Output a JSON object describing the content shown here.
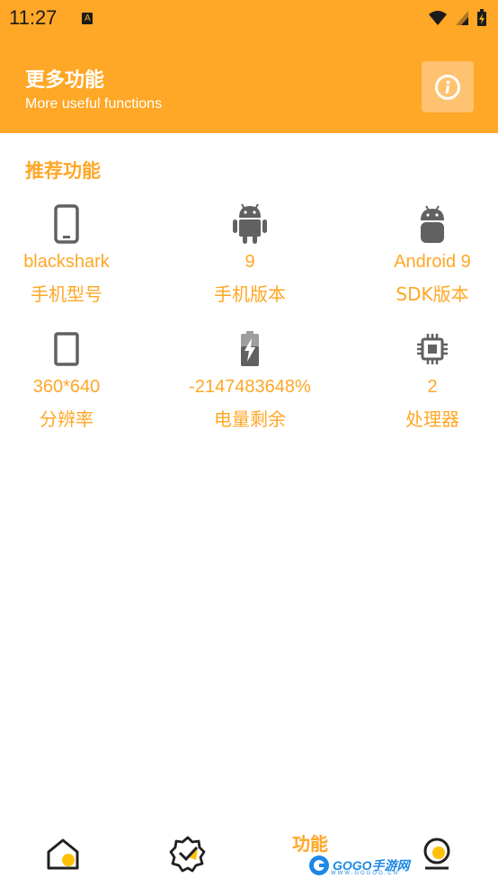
{
  "status_bar": {
    "time": "11:27",
    "notification_letter": "A"
  },
  "header": {
    "title": "更多功能",
    "subtitle": "More useful functions",
    "info_icon": "info-icon"
  },
  "section": {
    "title": "推荐功能"
  },
  "features": [
    {
      "icon": "phone-icon",
      "value": "blackshark",
      "label": "手机型号"
    },
    {
      "icon": "android-icon",
      "value": "9",
      "label": "手机版本"
    },
    {
      "icon": "android-head-icon",
      "value": "Android 9",
      "label": "SDK版本"
    },
    {
      "icon": "tablet-icon",
      "value": "360*640",
      "label": "分辨率"
    },
    {
      "icon": "battery-charging-icon",
      "value": "-2147483648%",
      "label": "电量剩余"
    },
    {
      "icon": "cpu-icon",
      "value": "2",
      "label": "处理器"
    }
  ],
  "bottom_nav": {
    "active_label": "功能"
  },
  "watermark": {
    "text": "GOGO手游网",
    "sub": "WWW.GOGOO.CN"
  },
  "colors": {
    "accent": "#ffa726",
    "icon_gray": "#616161"
  }
}
